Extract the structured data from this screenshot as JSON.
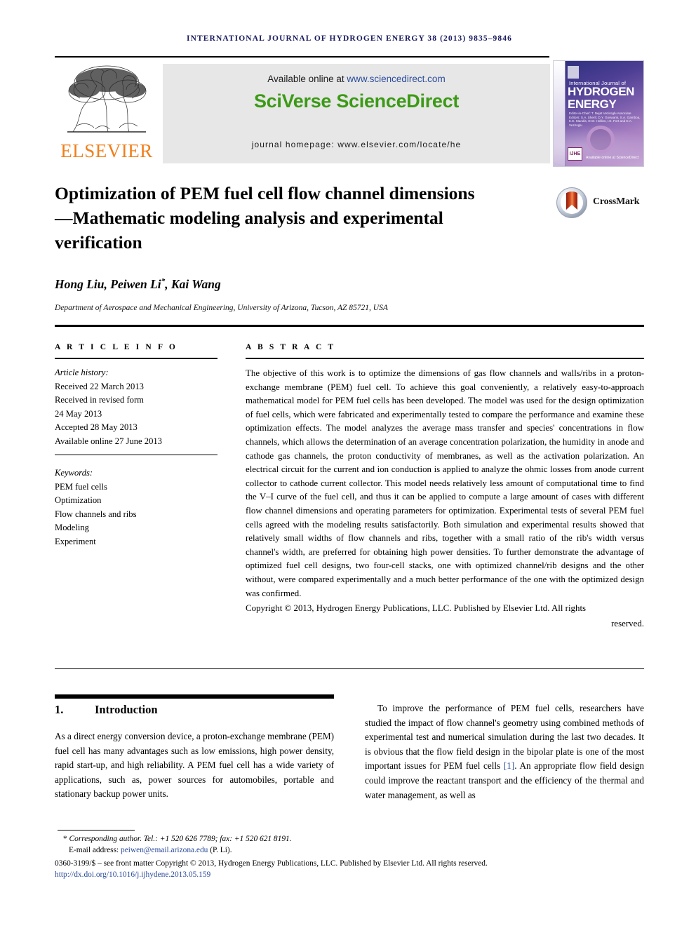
{
  "running_head": "INTERNATIONAL JOURNAL OF HYDROGEN ENERGY 38 (2013) 9835–9846",
  "banner": {
    "publisher_name": "ELSEVIER",
    "available_prefix": "Available online at ",
    "available_url": "www.sciencedirect.com",
    "platform": "SciVerse ScienceDirect",
    "homepage": "journal homepage: www.elsevier.com/locate/he"
  },
  "cover": {
    "supertitle": "International Journal of",
    "title_line1": "HYDROGEN",
    "title_line2": "ENERGY",
    "editors": "Editor-in-Chief: T. Nejat Veziroglu\nAssociate Editors: S.A. Sherif, D.Y. Goswami, S.A. Gamboa,\nK.E. Mandis, D.W. Hollins,\nI.E. Fort and E.A. Veziroglu",
    "badge": "IJHE",
    "sciencedirect": "Available online at\nScienceDirect"
  },
  "article": {
    "title": "Optimization of PEM fuel cell flow channel dimensions—Mathematic modeling analysis and experimental verification",
    "authors": "Hong Liu, Peiwen Li",
    "authors_suffix": ", Kai Wang",
    "corresponding_marker": "*",
    "affiliation": "Department of Aerospace and Mechanical Engineering, University of Arizona, Tucson, AZ 85721, USA",
    "crossmark_label": "CrossMark"
  },
  "info": {
    "label": "A R T I C L E   I N F O",
    "history_label": "Article history:",
    "history": [
      "Received 22 March 2013",
      "Received in revised form",
      "24 May 2013",
      "Accepted 28 May 2013",
      "Available online 27 June 2013"
    ],
    "keywords_label": "Keywords:",
    "keywords": [
      "PEM fuel cells",
      "Optimization",
      "Flow channels and ribs",
      "Modeling",
      "Experiment"
    ]
  },
  "abstract": {
    "label": "A B S T R A C T",
    "text": "The objective of this work is to optimize the dimensions of gas flow channels and walls/ribs in a proton-exchange membrane (PEM) fuel cell. To achieve this goal conveniently, a relatively easy-to-approach mathematical model for PEM fuel cells has been developed. The model was used for the design optimization of fuel cells, which were fabricated and experimentally tested to compare the performance and examine these optimization effects. The model analyzes the average mass transfer and species' concentrations in flow channels, which allows the determination of an average concentration polarization, the humidity in anode and cathode gas channels, the proton conductivity of membranes, as well as the activation polarization. An electrical circuit for the current and ion conduction is applied to analyze the ohmic losses from anode current collector to cathode current collector. This model needs relatively less amount of computational time to find the V–I curve of the fuel cell, and thus it can be applied to compute a large amount of cases with different flow channel dimensions and operating parameters for optimization. Experimental tests of several PEM fuel cells agreed with the modeling results satisfactorily. Both simulation and experimental results showed that relatively small widths of flow channels and ribs, together with a small ratio of the rib's width versus channel's width, are preferred for obtaining high power densities. To further demonstrate the advantage of optimized fuel cell designs, two four-cell stacks, one with optimized channel/rib designs and the other without, were compared experimentally and a much better performance of the one with the optimized design was confirmed.",
    "copyright": "Copyright © 2013, Hydrogen Energy Publications, LLC. Published by Elsevier Ltd. All rights",
    "copyright_end": "reserved."
  },
  "body": {
    "section_number": "1.",
    "section_title": "Introduction",
    "left_paragraph": "As a direct energy conversion device, a proton-exchange membrane (PEM) fuel cell has many advantages such as low emissions, high power density, rapid start-up, and high reliability. A PEM fuel cell has a wide variety of applications, such as, power sources for automobiles, portable and stationary backup power units.",
    "right_paragraph_part1": "To improve the performance of PEM fuel cells, researchers have studied the impact of flow channel's geometry using combined methods of experimental test and numerical simulation during the last two decades. It is obvious that the flow field design in the bipolar plate is one of the most important issues for PEM fuel cells ",
    "right_citation": "[1]",
    "right_paragraph_part2": ". An appropriate flow field design could improve the reactant transport and the efficiency of the thermal and water management, as well as"
  },
  "footer": {
    "corresponding": "Corresponding author. Tel.: +1 520 626 7789; fax: +1 520 621 8191.",
    "email_label": "E-mail address: ",
    "email": "peiwen@email.arizona.edu",
    "email_suffix": " (P. Li).",
    "issn_line": "0360-3199/$ – see front matter Copyright © 2013, Hydrogen Energy Publications, LLC. Published by Elsevier Ltd. All rights reserved.",
    "doi": "http://dx.doi.org/10.1016/j.ijhydene.2013.05.159"
  },
  "colors": {
    "running_head": "#1a1a5e",
    "elsevier_orange": "#f07f1a",
    "sciencedirect_green": "#3c9a16",
    "link_blue": "#2a4b9b"
  }
}
